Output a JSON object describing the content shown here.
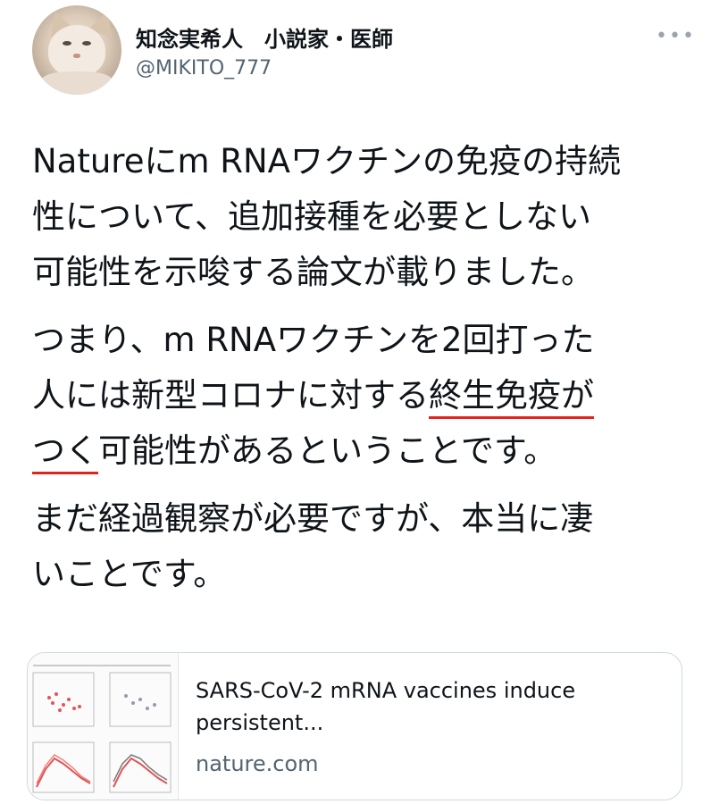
{
  "author": {
    "display_name": "知念実希人　小説家・医師",
    "handle": "@MIKITO_777",
    "more_icon": "more-horizontal-icon"
  },
  "tweet": {
    "para1": [
      "Natureにm RNAワクチンの免疫の持続",
      "性について、追加接種を必要としない",
      "可能性を示唆する論文が載りました。"
    ],
    "para2": {
      "line1": "つまり、m RNAワクチンを2回打った",
      "line2_pre": "人には新型コロナに対する",
      "line2_u": "終生免疫が",
      "line3_u": "つく",
      "line3_post": "可能性があるということです。"
    },
    "para3": [
      "まだ経過観察が必要ですが、本当に凄",
      "いことです。"
    ],
    "underline_color": "#e0241e"
  },
  "link_card": {
    "title_lines": [
      "SARS-CoV-2 mRNA vaccines induce",
      "persistent..."
    ],
    "domain": "nature.com",
    "thumbnail_icon": "figure-thumbnail-icon"
  }
}
